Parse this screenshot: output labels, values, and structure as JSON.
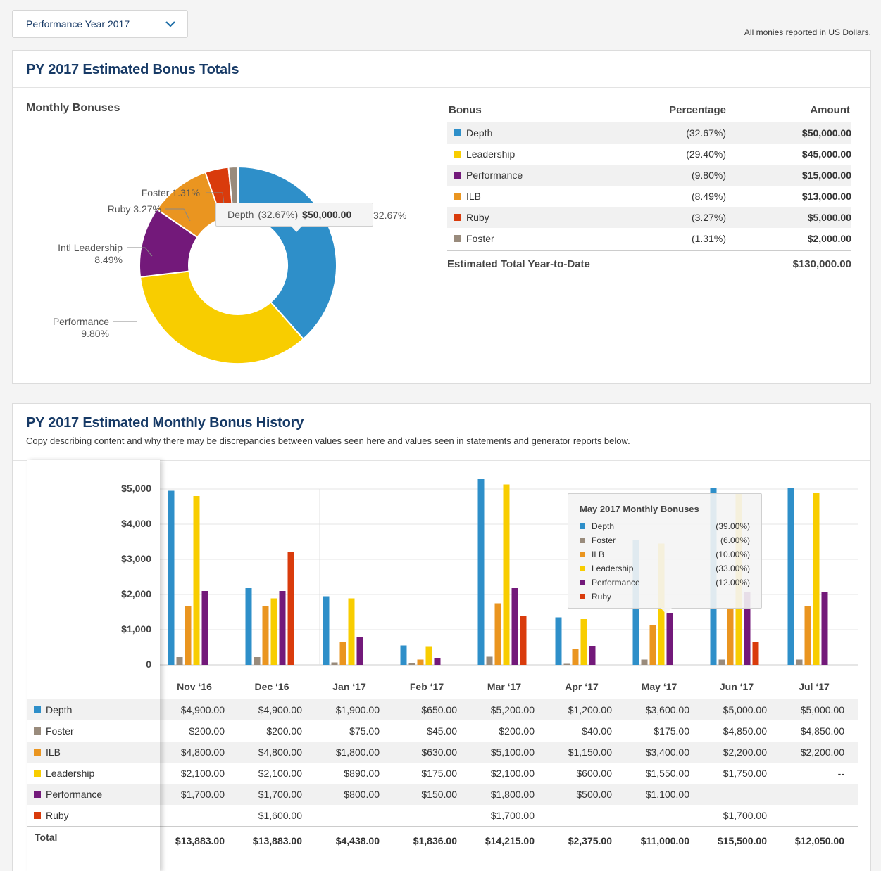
{
  "selector": {
    "value": "Performance Year 2017"
  },
  "currency_note": "All monies reported in US Dollars.",
  "totals_card": {
    "title": "PY 2017 Estimated Bonus Totals",
    "chart_title": "Monthly Bonuses",
    "tooltip": {
      "name": "Depth",
      "pct": "(32.67%)",
      "amount": "$50,000.00",
      "tail": "32.67%"
    },
    "table": {
      "headers": {
        "bonus": "Bonus",
        "percentage": "Percentage",
        "amount": "Amount"
      },
      "rows": [
        {
          "name": "Depth",
          "pct": "(32.67%)",
          "amount": "$50,000.00"
        },
        {
          "name": "Leadership",
          "pct": "(29.40%)",
          "amount": "$45,000.00"
        },
        {
          "name": "Performance",
          "pct": "(9.80%)",
          "amount": "$15,000.00"
        },
        {
          "name": "ILB",
          "pct": "(8.49%)",
          "amount": "$13,000.00"
        },
        {
          "name": "Ruby",
          "pct": "(3.27%)",
          "amount": "$5,000.00"
        },
        {
          "name": "Foster",
          "pct": "(1.31%)",
          "amount": "$2,000.00"
        }
      ],
      "total_label": "Estimated Total Year-to-Date",
      "total_value": "$130,000.00"
    }
  },
  "colors": {
    "Depth": "#2e8fc9",
    "Foster": "#998b7c",
    "ILB": "#ea9520",
    "Leadership": "#f8cd00",
    "Performance": "#73197a",
    "Ruby": "#d93b0c"
  },
  "history_card": {
    "title": "PY 2017 Estimated Monthly Bonus History",
    "subtitle": "Copy describing content and why there may be discrepancies between values seen here and values seen in statements and generator reports below.",
    "row_labels": [
      "Depth",
      "Foster",
      "ILB",
      "Leadership",
      "Performance",
      "Ruby"
    ],
    "total_label": "Total",
    "hidden_col_edge": [
      "0",
      "0",
      "0",
      "0",
      "0",
      "",
      "0"
    ],
    "months": [
      {
        "label": "Nov ‘16",
        "cells": [
          "$4,900.00",
          "$200.00",
          "$4,800.00",
          "$2,100.00",
          "$1,700.00",
          ""
        ],
        "total": "$13,883.00"
      },
      {
        "label": "Dec ‘16",
        "cells": [
          "$4,900.00",
          "$200.00",
          "$4,800.00",
          "$2,100.00",
          "$1,700.00",
          "$1,600.00"
        ],
        "total": "$13,883.00"
      },
      {
        "label": "Jan ‘17",
        "cells": [
          "$1,900.00",
          "$75.00",
          "$1,800.00",
          "$890.00",
          "$800.00",
          ""
        ],
        "total": "$4,438.00"
      },
      {
        "label": "Feb ‘17",
        "cells": [
          "$650.00",
          "$45.00",
          "$630.00",
          "$175.00",
          "$150.00",
          ""
        ],
        "total": "$1,836.00"
      },
      {
        "label": "Mar ‘17",
        "cells": [
          "$5,200.00",
          "$200.00",
          "$5,100.00",
          "$2,100.00",
          "$1,800.00",
          "$1,700.00"
        ],
        "total": "$14,215.00"
      },
      {
        "label": "Apr ‘17",
        "cells": [
          "$1,200.00",
          "$40.00",
          "$1,150.00",
          "$600.00",
          "$500.00",
          ""
        ],
        "total": "$2,375.00"
      },
      {
        "label": "May ‘17",
        "cells": [
          "$3,600.00",
          "$175.00",
          "$3,400.00",
          "$1,550.00",
          "$1,100.00",
          ""
        ],
        "total": "$11,000.00"
      },
      {
        "label": "Jun ‘17",
        "cells": [
          "$5,000.00",
          "$4,850.00",
          "$2,200.00",
          "$1,750.00",
          "",
          "$1,700.00"
        ],
        "total": "$15,500.00"
      },
      {
        "label": "Jul ‘17",
        "cells": [
          "$5,000.00",
          "$4,850.00",
          "$2,200.00",
          "--",
          "",
          ""
        ],
        "total": "$12,050.00"
      }
    ],
    "tooltip": {
      "title": "May 2017 Monthly Bonuses",
      "rows": [
        {
          "name": "Depth",
          "pct": "(39.00%)"
        },
        {
          "name": "Foster",
          "pct": "(6.00%)"
        },
        {
          "name": "ILB",
          "pct": "(10.00%)"
        },
        {
          "name": "Leadership",
          "pct": "(33.00%)"
        },
        {
          "name": "Performance",
          "pct": "(12.00%)"
        },
        {
          "name": "Ruby",
          "pct": ""
        }
      ]
    }
  },
  "chart_data": [
    {
      "type": "pie",
      "title": "Monthly Bonuses",
      "labels": [
        "Depth",
        "Leadership",
        "Performance",
        "Intl Leadership",
        "Ruby",
        "Foster"
      ],
      "values": [
        32.67,
        29.4,
        9.8,
        8.49,
        3.27,
        1.31
      ],
      "value_labels": [
        "32.67%",
        "29.40%",
        "9.80%",
        "8.49%",
        "3.27%",
        "1.31%"
      ]
    },
    {
      "type": "bar",
      "title": "PY 2017 Estimated Monthly Bonus History",
      "categories": [
        "Nov ‘16",
        "Dec ‘16",
        "Jan ‘17",
        "Feb ‘17",
        "Mar ‘17",
        "Apr ‘17",
        "May ‘17",
        "Jun ‘17",
        "Jul ‘17"
      ],
      "ylim": [
        0,
        5000
      ],
      "yticks": [
        "0",
        "$1,000",
        "$2,000",
        "$3,000",
        "$4,000",
        "$5,000"
      ],
      "grid": true,
      "series": [
        {
          "name": "Depth",
          "values": [
            4950,
            2180,
            1950,
            550,
            5280,
            1350,
            3550,
            5030,
            5030
          ]
        },
        {
          "name": "Foster",
          "values": [
            220,
            220,
            70,
            40,
            230,
            30,
            150,
            150,
            150
          ]
        },
        {
          "name": "ILB",
          "values": [
            1680,
            1680,
            650,
            150,
            1750,
            460,
            1130,
            1600,
            1680
          ]
        },
        {
          "name": "Leadership",
          "values": [
            4800,
            1890,
            1890,
            530,
            5130,
            1300,
            3450,
            4880,
            4880
          ]
        },
        {
          "name": "Performance",
          "values": [
            2100,
            2100,
            790,
            200,
            2180,
            540,
            1460,
            2080,
            2080
          ]
        },
        {
          "name": "Ruby",
          "values": [
            0,
            3220,
            0,
            0,
            1380,
            0,
            0,
            660,
            0
          ]
        }
      ]
    }
  ]
}
